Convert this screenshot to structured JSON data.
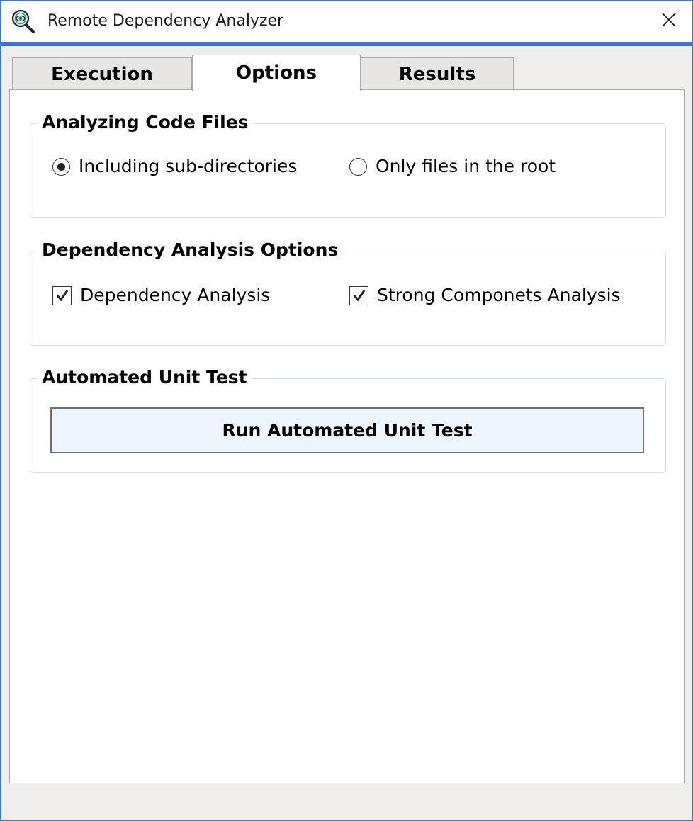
{
  "window": {
    "title": "Remote Dependency Analyzer",
    "app_icon": "magnifier-eye-icon",
    "close_icon": "close-icon"
  },
  "tabs": [
    {
      "label": "Execution",
      "selected": false
    },
    {
      "label": "Options",
      "selected": true
    },
    {
      "label": "Results",
      "selected": false
    }
  ],
  "analyzing_code_files": {
    "header": "Analyzing Code Files",
    "options": [
      {
        "label": "Including sub-directories",
        "checked": true
      },
      {
        "label": "Only files in the root",
        "checked": false
      }
    ]
  },
  "dependency_analysis_options": {
    "header": "Dependency Analysis Options",
    "options": [
      {
        "label": "Dependency Analysis",
        "checked": true
      },
      {
        "label": "Strong Componets Analysis",
        "checked": true
      }
    ]
  },
  "automated_unit_test": {
    "header": "Automated Unit Test",
    "button_label": "Run Automated Unit Test"
  },
  "colors": {
    "accent": "#3b70d8",
    "window_background": "#f0eeed",
    "panel_background": "#ffffff",
    "button_background": "#eef5fc",
    "group_border": "#d6dfe6"
  }
}
